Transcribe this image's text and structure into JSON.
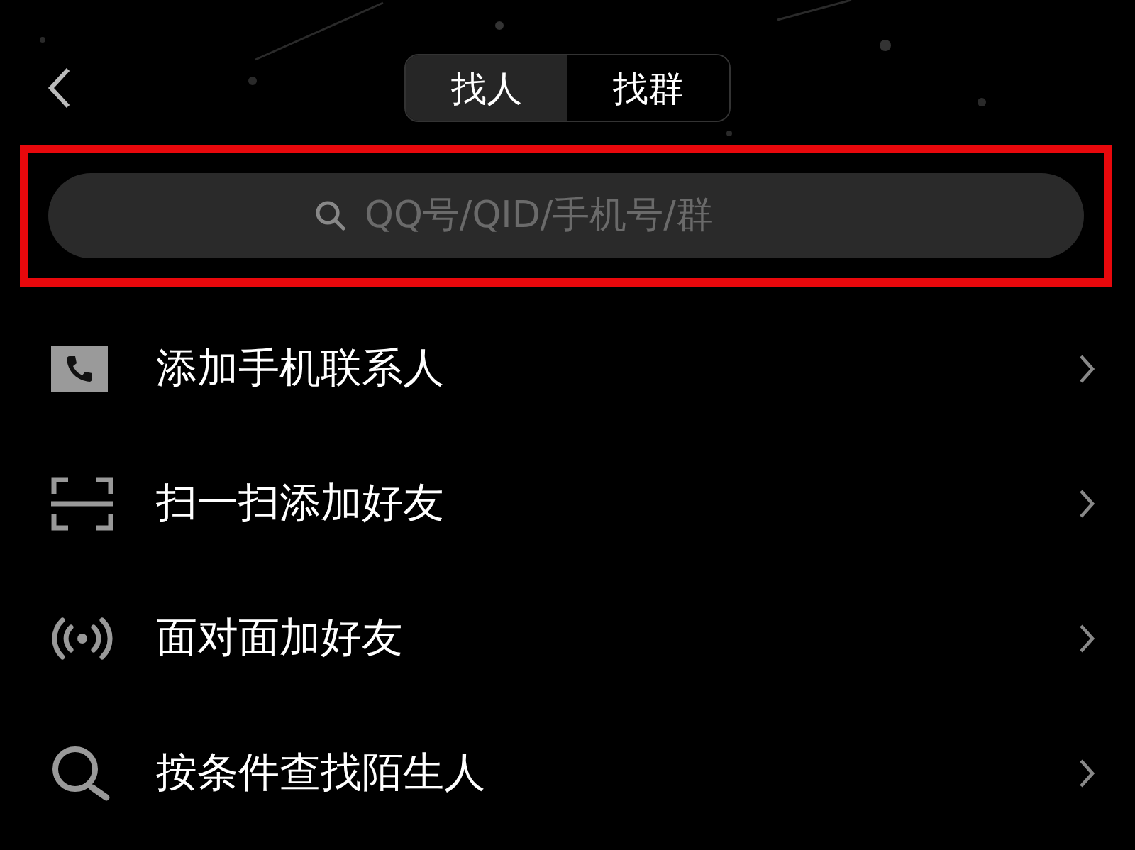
{
  "tabs": [
    {
      "label": "找人",
      "selected": true
    },
    {
      "label": "找群",
      "selected": false
    }
  ],
  "search": {
    "placeholder": "QQ号/QID/手机号/群",
    "highlighted": true
  },
  "menu": [
    {
      "kind": "phone",
      "label": "添加手机联系人"
    },
    {
      "kind": "scan",
      "label": "扫一扫添加好友"
    },
    {
      "kind": "nearby",
      "label": "面对面加好友"
    },
    {
      "kind": "search",
      "label": "按条件查找陌生人"
    }
  ]
}
